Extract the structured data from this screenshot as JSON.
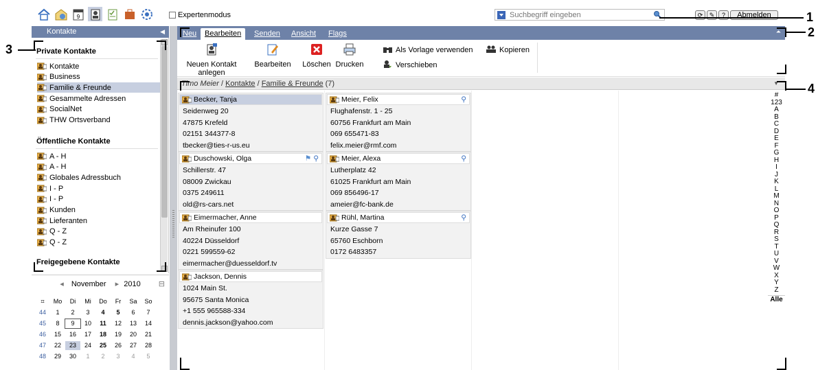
{
  "topbar": {
    "expert_label": "Expertenmodus",
    "search_placeholder": "Suchbegriff eingeben",
    "logout_label": "Abmelden"
  },
  "left": {
    "header": "Kontakte",
    "private_title": "Private Kontakte",
    "private_items": [
      "Kontakte",
      "Business",
      "Familie & Freunde",
      "Gesammelte Adressen",
      "SocialNet",
      "THW Ortsverband"
    ],
    "public_title": "Öffentliche Kontakte",
    "public_items": [
      "A - H",
      "A - H",
      "Globales Adressbuch",
      "I - P",
      "I - P",
      "Kunden",
      "Lieferanten",
      "Q - Z",
      "Q - Z"
    ],
    "shared_title": "Freigegebene Kontakte"
  },
  "calendar": {
    "month": "November",
    "year": "2010",
    "weekdays": [
      "Mo",
      "Di",
      "Mi",
      "Do",
      "Fr",
      "Sa",
      "So"
    ],
    "weeks": [
      {
        "wk": "44",
        "days": [
          "1",
          "2",
          "3",
          "4",
          "5",
          "6",
          "7"
        ]
      },
      {
        "wk": "45",
        "days": [
          "8",
          "9",
          "10",
          "11",
          "12",
          "13",
          "14"
        ]
      },
      {
        "wk": "46",
        "days": [
          "15",
          "16",
          "17",
          "18",
          "19",
          "20",
          "21"
        ]
      },
      {
        "wk": "47",
        "days": [
          "22",
          "23",
          "24",
          "25",
          "26",
          "27",
          "28"
        ]
      },
      {
        "wk": "48",
        "days": [
          "29",
          "30",
          "1",
          "2",
          "3",
          "4",
          "5"
        ]
      }
    ]
  },
  "tabs": [
    {
      "label": "Neu"
    },
    {
      "label": "Bearbeiten"
    },
    {
      "label": "Senden"
    },
    {
      "label": "Ansicht"
    },
    {
      "label": "Flags"
    }
  ],
  "toolbar": {
    "new_contact": "Neuen Kontakt anlegen",
    "edit": "Bearbeiten",
    "delete": "Löschen",
    "print": "Drucken",
    "use_template": "Als Vorlage verwenden",
    "move": "Verschieben",
    "copy": "Kopieren"
  },
  "breadcrumb": {
    "user": "Timo Meier",
    "sep1": " / ",
    "folder1": "Kontakte",
    "sep2": " / ",
    "folder2": "Familie & Freunde",
    "count": " (7)"
  },
  "contacts": [
    {
      "name": "Becker, Tanja",
      "lines": [
        "Seidenweg 20",
        "47875 Krefeld",
        "02151 344377-8",
        "tbecker@ties-r-us.eu"
      ]
    },
    {
      "name": "Duschowski, Olga",
      "lines": [
        "Schillerstr. 47",
        "08009 Zwickau",
        "0375 249611",
        "old@rs-cars.net"
      ]
    },
    {
      "name": "Eimermacher, Anne",
      "lines": [
        "Am Rheinufer 100",
        "40224 Düsseldorf",
        "0221 599559-62",
        "eimermacher@duesseldorf.tv"
      ]
    },
    {
      "name": "Jackson, Dennis",
      "lines": [
        "1024 Main St.",
        "95675 Santa Monica",
        "+1 555 965588-334",
        "dennis.jackson@yahoo.com"
      ]
    },
    {
      "name": "Meier, Felix",
      "lines": [
        "Flughafenstr. 1 - 25",
        "60756 Frankfurt am Main",
        "069 655471-83",
        "felix.meier@rmf.com"
      ]
    },
    {
      "name": "Meier, Alexa",
      "lines": [
        "Lutherplatz 42",
        "61025 Frankfurt am Main",
        "069 856496-17",
        "ameier@fc-bank.de"
      ]
    },
    {
      "name": "Rühl, Martina",
      "lines": [
        "Kurze Gasse 7",
        "65760 Eschborn",
        "0172 6483357"
      ]
    }
  ],
  "alphabet": [
    "#",
    "123",
    "A",
    "B",
    "C",
    "D",
    "E",
    "F",
    "G",
    "H",
    "I",
    "J",
    "K",
    "L",
    "M",
    "N",
    "O",
    "P",
    "Q",
    "R",
    "S",
    "T",
    "U",
    "V",
    "W",
    "X",
    "Y",
    "Z"
  ],
  "alphabet_all": "Alle",
  "callouts": [
    "1",
    "2",
    "3",
    "4"
  ],
  "colors": {
    "header_blue": "#6e82a8",
    "selection": "#c7cfe0",
    "panel_gray": "#c8cbd1"
  },
  "icons": [
    "home-icon",
    "mail-icon",
    "calendar-icon",
    "contacts-icon",
    "tasks-icon",
    "infostore-icon",
    "settings-icon",
    "search-icon",
    "refresh-icon",
    "tools-icon",
    "help-icon",
    "contact-card-icon",
    "edit-icon",
    "delete-icon",
    "print-icon",
    "binoculars-icon",
    "move-icon",
    "distribution-icon",
    "flag-icon"
  ]
}
